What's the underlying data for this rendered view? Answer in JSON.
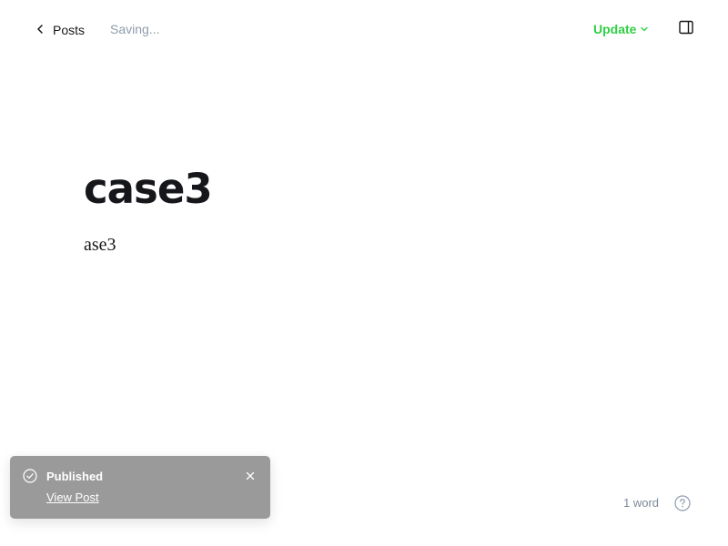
{
  "header": {
    "back_label": "Posts",
    "status": "Saving...",
    "update_label": "Update"
  },
  "editor": {
    "title": "case3",
    "body": "ase3"
  },
  "toast": {
    "title": "Published",
    "link_label": "View Post"
  },
  "footer": {
    "word_count": "1 word"
  },
  "icons": {
    "back": "chevron-left-icon",
    "update_dropdown": "chevron-down-icon",
    "sidebar": "sidebar-panel-icon",
    "toast_status": "check-circle-icon",
    "toast_close": "close-icon",
    "help": "help-circle-icon"
  },
  "colors": {
    "accent": "#30cf43",
    "muted_text": "#8e9cac",
    "toast_bg": "#9a9a9a",
    "text": "#15171a"
  }
}
